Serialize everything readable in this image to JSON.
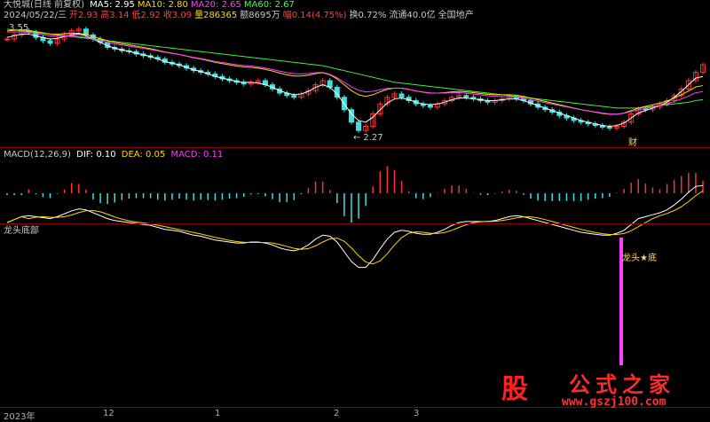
{
  "header": {
    "stock_name": "大悦城(日线 前复权)",
    "ma": [
      {
        "label": "MA5: 2.95",
        "color": "#ffffff"
      },
      {
        "label": "MA10: 2.80",
        "color": "#ffd700"
      },
      {
        "label": "MA20: 2.65",
        "color": "#ff40ff"
      },
      {
        "label": "MA60: 2.67",
        "color": "#40ff40"
      }
    ],
    "quote": [
      {
        "label": "2024/05/22/三",
        "color": "#c8c8c8"
      },
      {
        "label": "开2.93",
        "color": "#ff4040"
      },
      {
        "label": "高3.14",
        "color": "#ff4040"
      },
      {
        "label": "低2.92",
        "color": "#ff4040"
      },
      {
        "label": "收3.09",
        "color": "#ff4040"
      },
      {
        "label": "量286365",
        "color": "#ffd700"
      },
      {
        "label": "额8695万",
        "color": "#c8c8c8"
      },
      {
        "label": "幅0.14(4.75%)",
        "color": "#ff4040"
      },
      {
        "label": "换0.72%",
        "color": "#c8c8c8"
      },
      {
        "label": "流通40.0亿",
        "color": "#c8c8c8"
      },
      {
        "label": "全国地产",
        "color": "#c8c8c8"
      }
    ]
  },
  "price_panel": {
    "high_label": "3.55",
    "low_label": "2.27",
    "event_label": "财"
  },
  "macd_panel": {
    "title": "MACD(12,26,9)",
    "dif": "DIF: 0.10",
    "dea": "DEA: 0.05",
    "macd": "MACD: 0.11"
  },
  "indicator_panel": {
    "title": "龙头底部",
    "signal_label": "龙头★底"
  },
  "x_axis": {
    "ticks": [
      {
        "label": "2023年"
      },
      {
        "label": "12"
      },
      {
        "label": "1"
      },
      {
        "label": "2"
      },
      {
        "label": "3"
      }
    ]
  },
  "watermark": {
    "big": "股",
    "title": "公式之家",
    "url": "www.gszj100.com"
  },
  "chart_data": {
    "type": "line",
    "price_range": [
      2.27,
      3.55
    ],
    "close": [
      3.4,
      3.45,
      3.5,
      3.48,
      3.42,
      3.38,
      3.35,
      3.4,
      3.46,
      3.5,
      3.52,
      3.45,
      3.4,
      3.36,
      3.3,
      3.28,
      3.26,
      3.25,
      3.22,
      3.2,
      3.18,
      3.16,
      3.12,
      3.1,
      3.08,
      3.05,
      3.02,
      3.0,
      2.98,
      2.95,
      2.92,
      2.9,
      2.88,
      2.86,
      2.88,
      2.9,
      2.85,
      2.8,
      2.75,
      2.72,
      2.7,
      2.74,
      2.78,
      2.85,
      2.9,
      2.82,
      2.7,
      2.55,
      2.4,
      2.3,
      2.35,
      2.5,
      2.62,
      2.7,
      2.74,
      2.7,
      2.66,
      2.62,
      2.6,
      2.58,
      2.62,
      2.66,
      2.7,
      2.72,
      2.7,
      2.68,
      2.66,
      2.64,
      2.66,
      2.68,
      2.7,
      2.68,
      2.66,
      2.62,
      2.58,
      2.55,
      2.52,
      2.48,
      2.45,
      2.42,
      2.4,
      2.38,
      2.36,
      2.34,
      2.33,
      2.35,
      2.4,
      2.5,
      2.56,
      2.55,
      2.58,
      2.62,
      2.66,
      2.72,
      2.8,
      2.9,
      3.0,
      3.09
    ],
    "ma5": [
      3.42,
      3.44,
      3.46,
      3.46,
      3.44,
      3.42,
      3.4,
      3.41,
      3.43,
      3.45,
      3.46,
      3.44,
      3.4,
      3.36,
      3.32,
      3.29,
      3.27,
      3.25,
      3.23,
      3.21,
      3.19,
      3.16,
      3.13,
      3.11,
      3.09,
      3.06,
      3.03,
      3.01,
      2.98,
      2.95,
      2.93,
      2.91,
      2.89,
      2.88,
      2.88,
      2.87,
      2.85,
      2.82,
      2.78,
      2.75,
      2.73,
      2.74,
      2.77,
      2.82,
      2.85,
      2.82,
      2.74,
      2.62,
      2.5,
      2.42,
      2.4,
      2.46,
      2.55,
      2.63,
      2.68,
      2.69,
      2.67,
      2.64,
      2.62,
      2.61,
      2.62,
      2.64,
      2.67,
      2.69,
      2.69,
      2.68,
      2.67,
      2.66,
      2.66,
      2.67,
      2.68,
      2.68,
      2.66,
      2.63,
      2.6,
      2.57,
      2.54,
      2.51,
      2.48,
      2.45,
      2.42,
      2.4,
      2.38,
      2.36,
      2.35,
      2.36,
      2.39,
      2.45,
      2.51,
      2.54,
      2.57,
      2.6,
      2.64,
      2.7,
      2.77,
      2.85,
      2.93,
      2.95
    ],
    "ma60": [
      3.52,
      3.51,
      3.5,
      3.49,
      3.48,
      3.47,
      3.46,
      3.45,
      3.44,
      3.43,
      3.42,
      3.41,
      3.4,
      3.39,
      3.38,
      3.37,
      3.36,
      3.35,
      3.34,
      3.33,
      3.32,
      3.31,
      3.3,
      3.29,
      3.28,
      3.27,
      3.26,
      3.25,
      3.24,
      3.23,
      3.22,
      3.21,
      3.2,
      3.19,
      3.18,
      3.17,
      3.16,
      3.15,
      3.14,
      3.13,
      3.12,
      3.11,
      3.1,
      3.09,
      3.08,
      3.06,
      3.04,
      3.02,
      3.0,
      2.98,
      2.96,
      2.94,
      2.92,
      2.9,
      2.88,
      2.87,
      2.86,
      2.85,
      2.84,
      2.83,
      2.82,
      2.81,
      2.8,
      2.79,
      2.78,
      2.77,
      2.76,
      2.75,
      2.74,
      2.73,
      2.72,
      2.71,
      2.7,
      2.69,
      2.68,
      2.67,
      2.66,
      2.65,
      2.64,
      2.63,
      2.62,
      2.61,
      2.6,
      2.59,
      2.58,
      2.57,
      2.57,
      2.57,
      2.57,
      2.58,
      2.59,
      2.6,
      2.61,
      2.62,
      2.63,
      2.64,
      2.66,
      2.67
    ]
  }
}
